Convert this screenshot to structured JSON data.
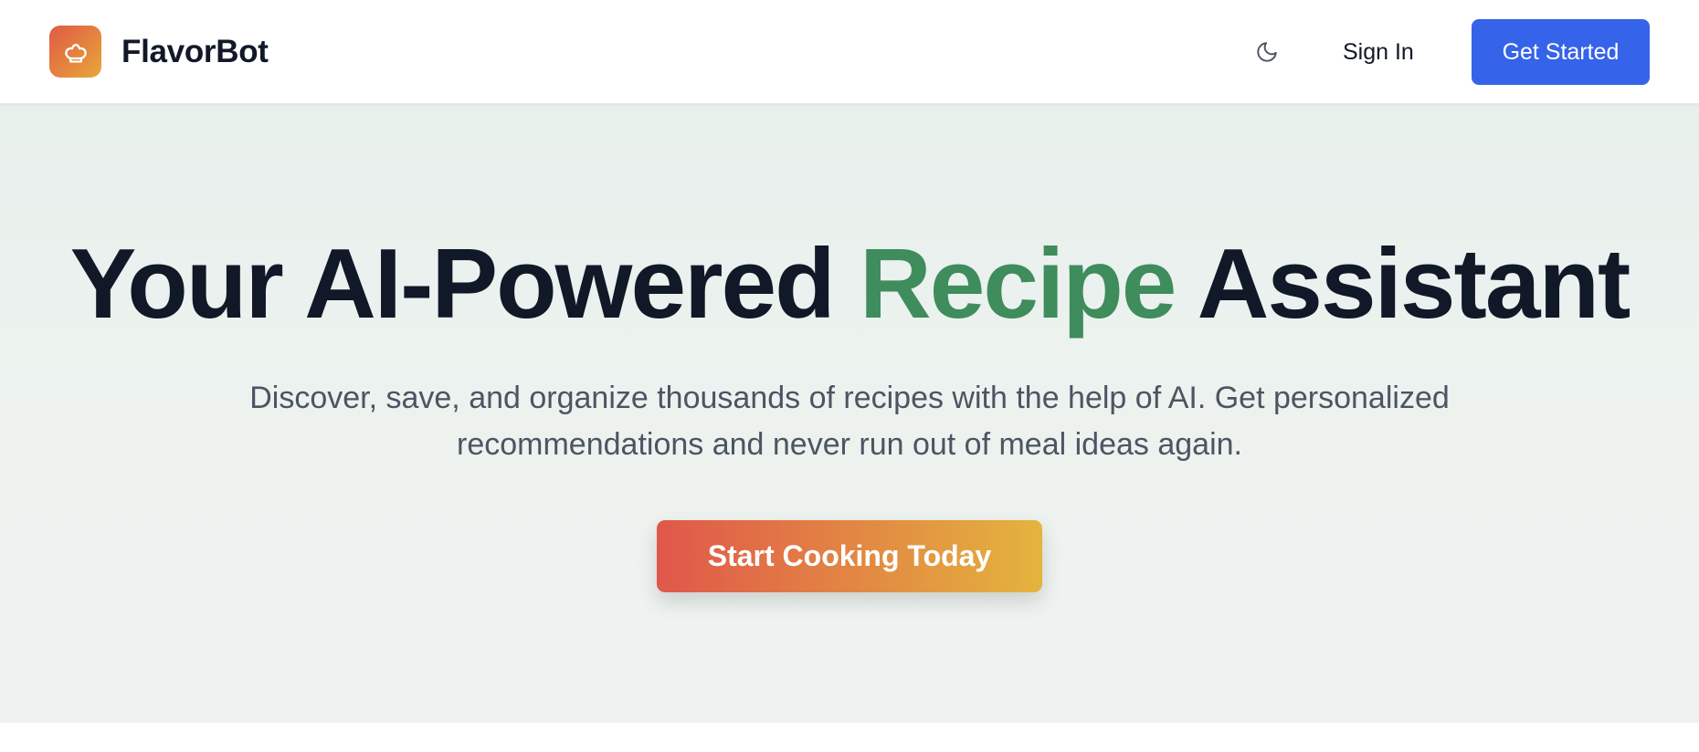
{
  "brand": {
    "name": "FlavorBot",
    "logo_icon": "chef-hat-icon"
  },
  "nav": {
    "theme_toggle_icon": "moon-icon",
    "sign_in_label": "Sign In",
    "get_started_label": "Get Started"
  },
  "hero": {
    "title_prefix": "Your AI-Powered ",
    "title_highlight": "Recipe",
    "title_suffix": " Assistant",
    "subtitle": "Discover, save, and organize thousands of recipes with the help of AI. Get personalized recommendations and never run out of meal ideas again.",
    "cta_label": "Start Cooking Today"
  },
  "colors": {
    "primary_button": "#3563e9",
    "accent_green": "#3f8c5d",
    "gradient_start": "#e0574a",
    "gradient_end": "#e4b43d",
    "heading": "#111827",
    "body_text": "#4b5563"
  }
}
